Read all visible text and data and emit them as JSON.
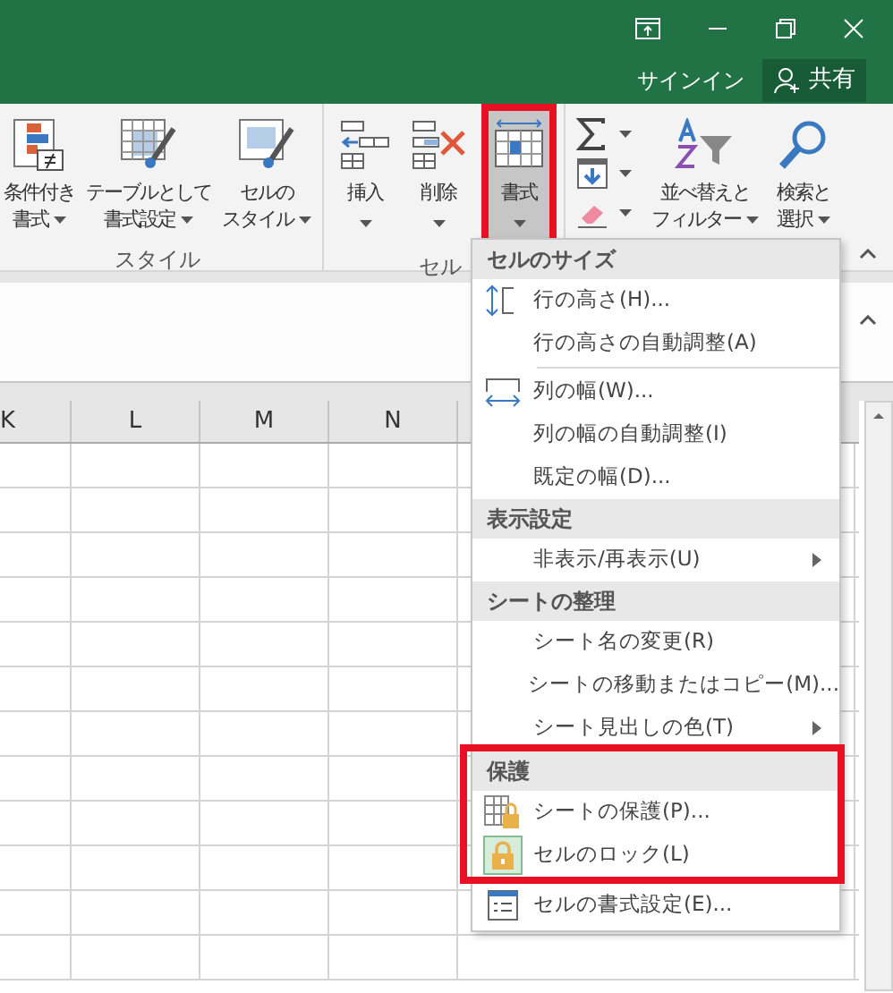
{
  "title_bar": {
    "sign_in": "サインイン",
    "share": "共有"
  },
  "ribbon": {
    "groups": [
      {
        "label": "スタイル",
        "buttons": [
          {
            "lines": [
              "条件付き",
              "書式"
            ],
            "dropdown": true,
            "highlighted": false,
            "pressed": false
          },
          {
            "lines": [
              "テーブルとして",
              "書式設定"
            ],
            "dropdown": true,
            "highlighted": false,
            "pressed": false
          },
          {
            "lines": [
              "セルの",
              "スタイル"
            ],
            "dropdown": true,
            "highlighted": false,
            "pressed": false
          }
        ]
      },
      {
        "label": "セル",
        "buttons": [
          {
            "lines": [
              "挿入"
            ],
            "dropdown": true,
            "highlighted": false,
            "pressed": false
          },
          {
            "lines": [
              "削除"
            ],
            "dropdown": true,
            "highlighted": false,
            "pressed": false
          },
          {
            "lines": [
              "書式"
            ],
            "dropdown": true,
            "highlighted": true,
            "pressed": true
          }
        ]
      },
      {
        "buttons": [
          {
            "lines": [
              "並べ替えと",
              "フィルター"
            ],
            "dropdown": true,
            "highlighted": false,
            "pressed": false
          },
          {
            "lines": [
              "検索と",
              "選択"
            ],
            "dropdown": true,
            "highlighted": false,
            "pressed": false
          }
        ]
      }
    ]
  },
  "sheet": {
    "columns": [
      "K",
      "L",
      "M",
      "N"
    ]
  },
  "menu": {
    "sections": [
      {
        "header": "セルのサイズ",
        "highlighted": false,
        "items": [
          {
            "kind": "item",
            "label": "行の高さ(H)...",
            "submenu": false,
            "checked": false
          },
          {
            "kind": "item",
            "label": "行の高さの自動調整(A)",
            "submenu": false,
            "checked": false
          },
          {
            "kind": "separator"
          },
          {
            "kind": "item",
            "label": "列の幅(W)...",
            "submenu": false,
            "checked": false
          },
          {
            "kind": "item",
            "label": "列の幅の自動調整(I)",
            "submenu": false,
            "checked": false
          },
          {
            "kind": "item",
            "label": "既定の幅(D)...",
            "submenu": false,
            "checked": false
          }
        ]
      },
      {
        "header": "表示設定",
        "highlighted": false,
        "items": [
          {
            "kind": "item",
            "label": "非表示/再表示(U)",
            "submenu": true,
            "checked": false
          }
        ]
      },
      {
        "header": "シートの整理",
        "highlighted": false,
        "items": [
          {
            "kind": "item",
            "label": "シート名の変更(R)",
            "submenu": false,
            "checked": false
          },
          {
            "kind": "item",
            "label": "シートの移動またはコピー(M)...",
            "submenu": false,
            "checked": false
          },
          {
            "kind": "item",
            "label": "シート見出しの色(T)",
            "submenu": true,
            "checked": false
          }
        ]
      },
      {
        "header": "保護",
        "highlighted": true,
        "items": [
          {
            "kind": "item",
            "label": "シートの保護(P)...",
            "submenu": false,
            "checked": false
          },
          {
            "kind": "item",
            "label": "セルのロック(L)",
            "submenu": false,
            "checked": true
          }
        ]
      },
      {
        "highlighted": false,
        "items": [
          {
            "kind": "item",
            "label": "セルの書式設定(E)...",
            "submenu": false,
            "checked": false
          }
        ]
      }
    ]
  }
}
